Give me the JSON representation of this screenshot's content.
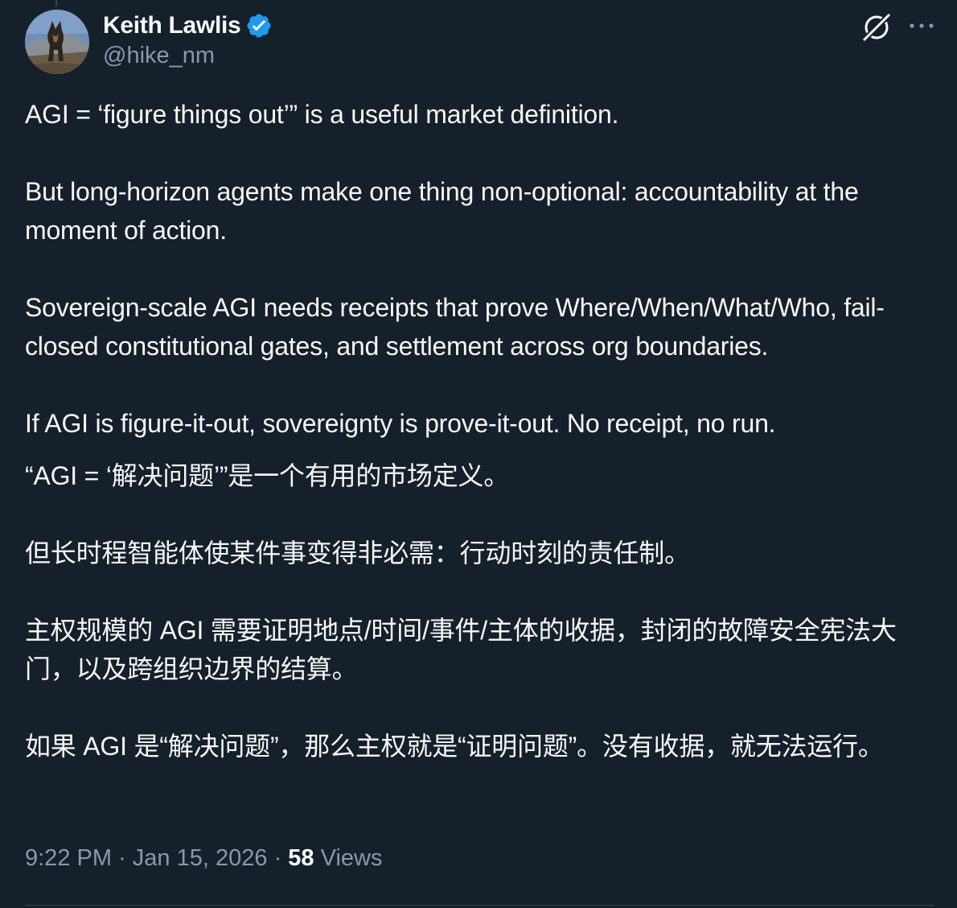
{
  "author": {
    "display_name": "Keith Lawlis",
    "handle": "@hike_nm",
    "verified": true,
    "verified_color": "#1d9bf0"
  },
  "icons": {
    "verified": "verified-badge-icon",
    "grok": "grok-icon",
    "more": "more-options-icon"
  },
  "tweet": {
    "en": [
      "AGI = ‘figure things out’” is a useful market definition.",
      "But long-horizon agents make one thing non-optional: accountability at the moment of action.",
      "Sovereign-scale AGI needs receipts that prove Where/When/What/Who, fail-closed constitutional gates, and settlement across org boundaries.",
      "If AGI is figure-it-out, sovereignty is prove-it-out. No receipt, no run."
    ],
    "zh": [
      "“AGI = ‘解决问题’”是一个有用的市场定义。",
      "但长时程智能体使某件事变得非必需：行动时刻的责任制。",
      "主权规模的 AGI 需要证明地点/时间/事件/主体的收据，封闭的故障安全宪法大门，以及跨组织边界的结算。",
      "如果 AGI 是“解决问题”，那么主权就是“证明问题”。没有收据，就无法运行。"
    ]
  },
  "meta": {
    "time": "9:22 PM",
    "separator": "·",
    "date": "Jan 15, 2026",
    "views_count": "58",
    "views_label": "Views"
  },
  "colors": {
    "background": "#15202b",
    "text_primary": "#f7f9f9",
    "text_secondary": "#8b98a5",
    "divider": "#38444d"
  }
}
